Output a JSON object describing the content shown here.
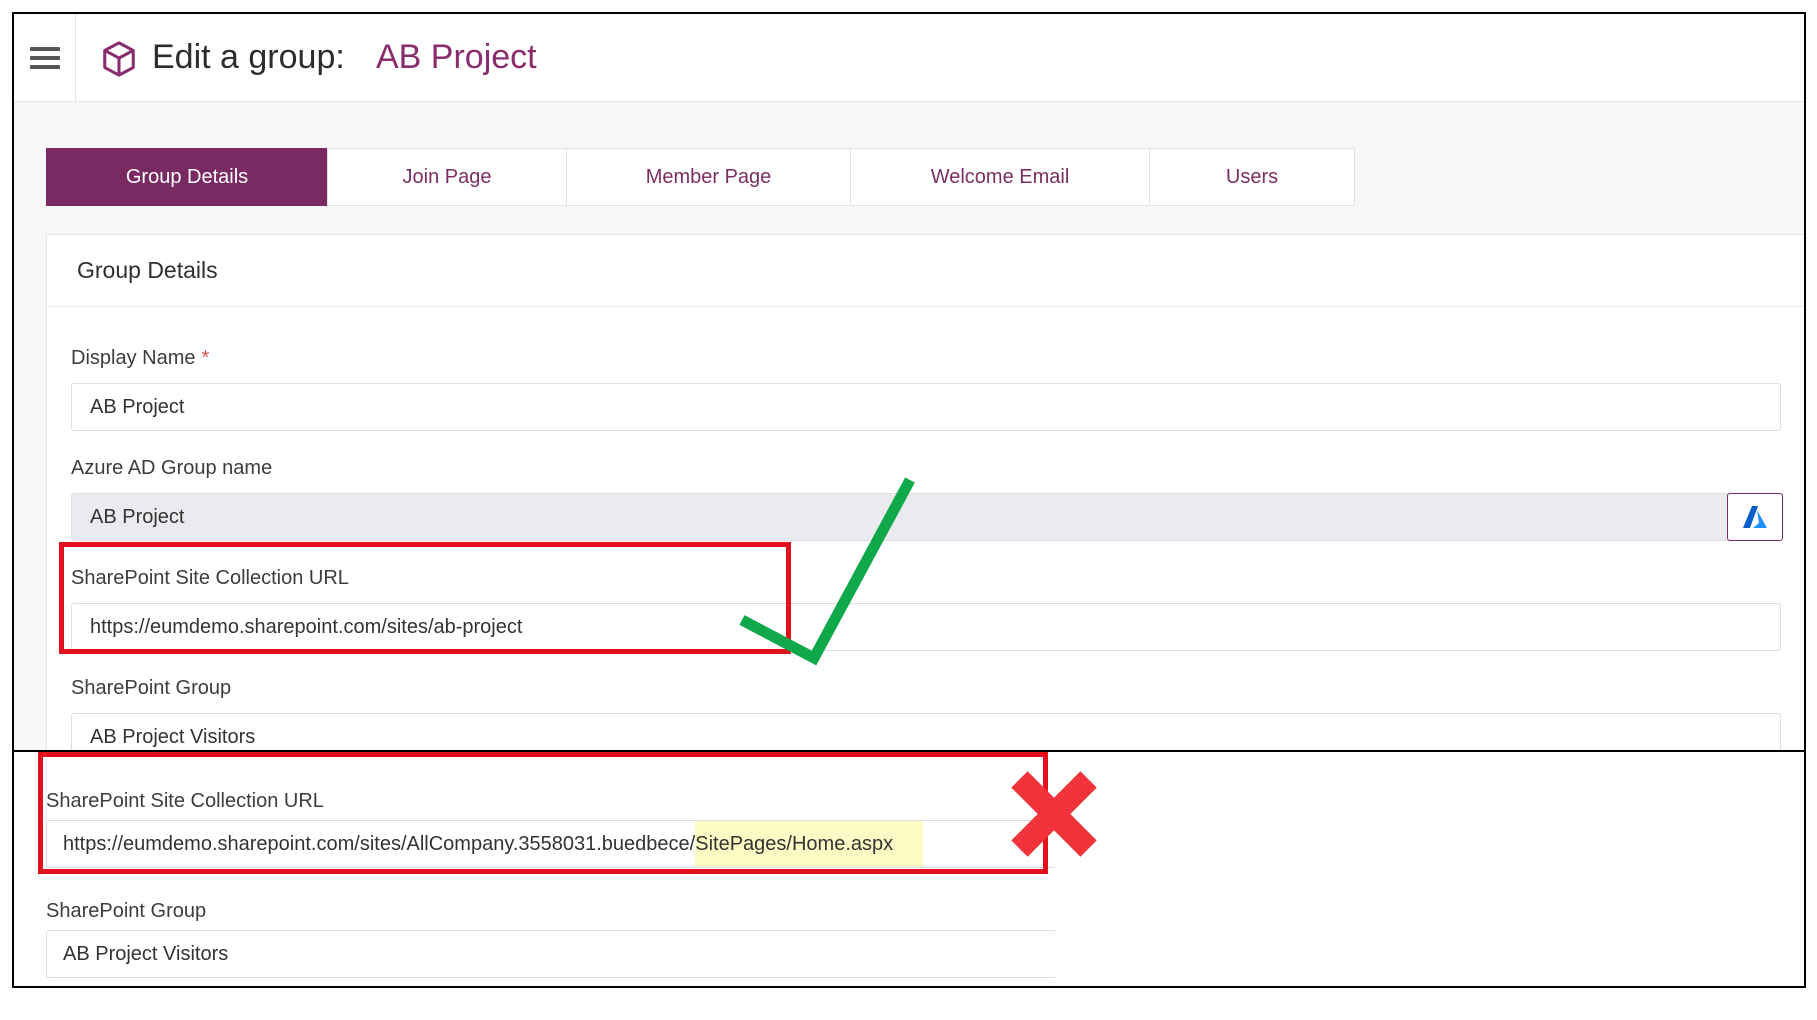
{
  "header": {
    "title_prefix": "Edit a group:",
    "group_name": "AB Project"
  },
  "tabs": [
    {
      "label": "Group Details",
      "active": true
    },
    {
      "label": "Join Page",
      "active": false
    },
    {
      "label": "Member Page",
      "active": false
    },
    {
      "label": "Welcome Email",
      "active": false
    },
    {
      "label": "Users",
      "active": false
    }
  ],
  "card": {
    "title": "Group Details",
    "display_name": {
      "label": "Display Name",
      "required_marker": "*",
      "value": "AB Project"
    },
    "azure_group": {
      "label": "Azure AD Group name",
      "value": "AB Project",
      "icon": "azure-logo-icon"
    },
    "sp_url": {
      "label": "SharePoint Site Collection URL",
      "value": "https://eumdemo.sharepoint.com/sites/ab-project"
    },
    "sp_group": {
      "label": "SharePoint Group",
      "value": "AB Project Visitors"
    }
  },
  "bad_example": {
    "sp_url_label": "SharePoint Site Collection URL",
    "sp_url_value_base": "https://eumdemo.sharepoint.com/sites/AllCompany.3558031.buedbece/",
    "sp_url_value_highlight": "SitePages/Home.aspx",
    "sp_group_label": "SharePoint Group",
    "sp_group_value": "AB Project Visitors"
  },
  "colors": {
    "brand": "#7a2a62",
    "title_accent": "#8a2d6e",
    "annotation_red": "#e1121b",
    "check_green": "#0fa84a",
    "cross_red": "#f2333b",
    "highlight": "#fdfbc4"
  }
}
